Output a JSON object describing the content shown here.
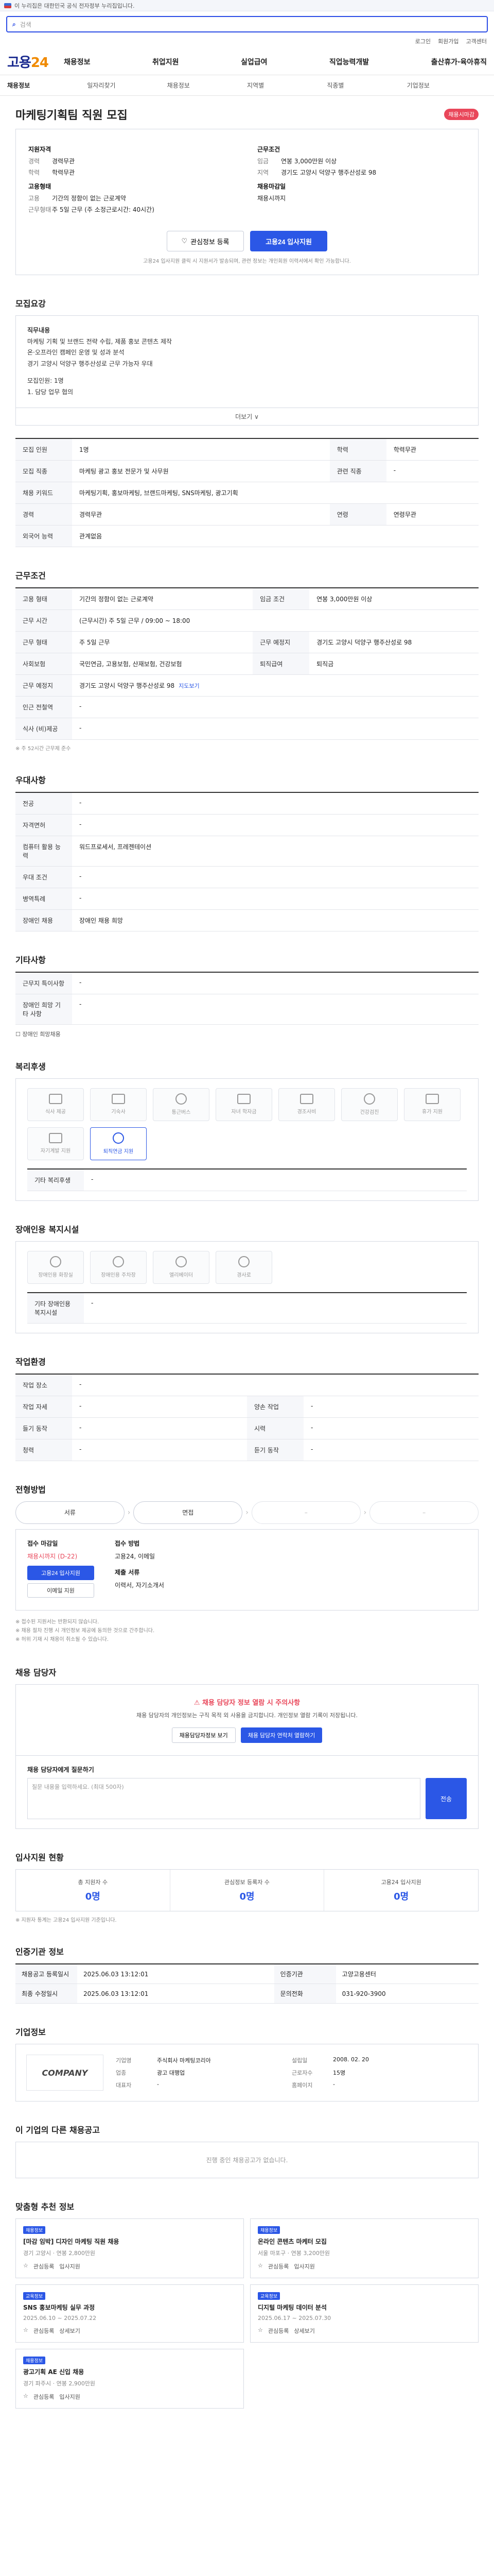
{
  "topbar": {
    "text": "이 누리집은 대한민국 공식 전자정부 누리집입니다."
  },
  "search": {
    "placeholder": "검색"
  },
  "util": {
    "items": [
      "로그인",
      "회원가입",
      "고객센터"
    ]
  },
  "logo": {
    "name": "고용",
    "num": "24"
  },
  "gnb": {
    "items": [
      "채용정보",
      "취업지원",
      "실업급여",
      "직업능력개발",
      "출산휴가·육아휴직"
    ]
  },
  "subnav": {
    "items": [
      "채용정보",
      "일자리찾기",
      "채용정보",
      "지역별",
      "직종별",
      "기업정보"
    ]
  },
  "job": {
    "title": "마케팅기획팀 직원 모집",
    "badge": "채용시마감",
    "left_label": "지원자격",
    "career_k": "경력",
    "career_v": "경력무관",
    "edu_k": "학력",
    "edu_v": "학력무관",
    "type_label": "고용형태",
    "type_k": "고용",
    "type_v": "기간의 정함이 없는 근로계약",
    "work_k": "근무형태",
    "work_v": "주 5일 근무 (주 소정근로시간: 40시간)",
    "right_label": "근무조건",
    "wage_k": "임금",
    "wage_v": "연봉 3,000만원 이상",
    "area_k": "지역",
    "area_v": "경기도 고양시 덕양구 행주산성로 98",
    "apply_label": "채용마감일",
    "apply_v": "채용시까지"
  },
  "actions": {
    "scrap": "관심정보 등록",
    "apply": "고용24 입사지원",
    "note": "고용24 입사지원 클릭 시 지원서가 발송되며, 관련 정보는 개인회원 이력서에서 확인 가능합니다."
  },
  "detail": {
    "title": "모집요강",
    "body": [
      "직무내용",
      "마케팅 기획 및 브랜드 전략 수립, 제품 홍보 콘텐츠 제작",
      "온·오프라인 캠페인 운영 및 성과 분석",
      "경기 고양시 덕양구 행주산성로 근무 가능자 우대",
      "",
      "모집인원: 1명",
      "1. 담당 업무 협의"
    ],
    "more": "더보기 ∨"
  },
  "recruit_table": [
    {
      "k": "모집 인원",
      "v": "1명",
      "k2": "학력",
      "v2": "학력무관"
    },
    {
      "k": "모집 직종",
      "v": "마케팅 광고 홍보 전문가 및 사무원",
      "k2": "관련 직종",
      "v2": "-"
    },
    {
      "k": "채용 키워드",
      "v": "마케팅기획, 홍보마케팅, 브랜드마케팅, SNS마케팅, 광고기획",
      "k2": "",
      "v2": ""
    },
    {
      "k": "경력",
      "v": "경력무관",
      "k2": "연령",
      "v2": "연령무관"
    },
    {
      "k": "외국어 능력",
      "v": "관계없음",
      "k2": "",
      "v2": ""
    }
  ],
  "work": {
    "title": "근무조건",
    "rows": [
      {
        "k": "고용 형태",
        "v": "기간의 정함이 없는 근로계약",
        "k2": "임금 조건",
        "v2": "연봉 3,000만원 이상"
      },
      {
        "k": "근무 시간",
        "v": "(근무시간) 주 5일 근무 / 09:00 ~ 18:00",
        "k2": "",
        "v2": ""
      },
      {
        "k": "근무 형태",
        "v": "주 5일 근무",
        "k2": "근무 예정지",
        "v2": "경기도 고양시 덕양구 행주산성로 98"
      },
      {
        "k": "사회보험",
        "v": "국민연금, 고용보험, 산재보험, 건강보험",
        "k2": "퇴직급여",
        "v2": "퇴직금"
      },
      {
        "k": "근무 예정지",
        "v": "경기도 고양시 덕양구 행주산성로 98",
        "k2": "",
        "v2": ""
      },
      {
        "k": "인근 전철역",
        "v": "-",
        "k2": "",
        "v2": ""
      },
      {
        "k": "식사 (비)제공",
        "v": "-",
        "k2": "",
        "v2": ""
      }
    ],
    "map": "지도보기",
    "note": "※ 주 52시간 근무제 준수"
  },
  "prefer": {
    "title": "우대사항",
    "rows": [
      {
        "k": "전공",
        "v": "-"
      },
      {
        "k": "자격면허",
        "v": "-"
      },
      {
        "k": "컴퓨터 활용 능력",
        "v": "워드프로세서, 프레젠테이션"
      },
      {
        "k": "우대 조건",
        "v": "-"
      },
      {
        "k": "병역특례",
        "v": "-"
      },
      {
        "k": "장애인 채용",
        "v": "장애인 채용 희망"
      }
    ]
  },
  "etc": {
    "title": "기타사항",
    "rows": [
      {
        "k": "근무지 특이사항",
        "v": "-"
      },
      {
        "k": "장애인 희망 기타 사항",
        "v": "-"
      }
    ],
    "checkbox": "장애인 희망채용"
  },
  "welfare": {
    "title": "복리후생",
    "tiles": [
      "식사 제공",
      "기숙사",
      "통근버스",
      "자녀 학자금",
      "경조사비",
      "건강검진",
      "휴가 지원",
      "자기계발 지원",
      "퇴직연금 지원"
    ],
    "active_index": 8,
    "extra_k": "기타 복리후생",
    "extra_v": "-"
  },
  "disabled": {
    "title": "장애인용 복지시설",
    "tiles": [
      "장애인용 화장실",
      "장애인용 주차장",
      "엘리베이터",
      "경사로"
    ],
    "extra_k": "기타 장애인용 복지시설",
    "extra_v": "-"
  },
  "env": {
    "title": "작업환경",
    "rows": [
      {
        "k": "작업 장소",
        "v": "-",
        "k2": "",
        "v2": ""
      },
      {
        "k": "작업 자세",
        "v": "-",
        "k2": "양손 작업",
        "v2": "-"
      },
      {
        "k": "들기 동작",
        "v": "-",
        "k2": "시력",
        "v2": "-"
      },
      {
        "k": "청력",
        "v": "-",
        "k2": "듣기 동작",
        "v2": "-"
      }
    ]
  },
  "process": {
    "title": "전형방법",
    "steps": [
      "서류",
      "면접",
      "",
      ""
    ],
    "apply_h": "접수 마감일",
    "apply_v": "채용시까지 (D-22)",
    "apply_btn": "고용24 입사지원",
    "email_btn": "이메일 지원",
    "method_h": "접수 방법",
    "method_v": "고용24, 이메일",
    "docs_h": "제출 서류",
    "docs_v": "이력서, 자기소개서",
    "notes": [
      "※ 접수된 지원서는 반환되지 않습니다.",
      "※ 채용 절차 진행 시 개인정보 제공에 동의한 것으로 간주합니다.",
      "※ 허위 기재 시 채용이 취소될 수 있습니다."
    ]
  },
  "contact": {
    "title": "채용 담당자",
    "warn": "채용 담당자 정보 열람 시 주의사항",
    "text": "채용 담당자의 개인정보는 구직 목적 외 사용을 금지합니다. 개인정보 열람 기록이 저장됩니다.",
    "btn1": "채용담당자정보 보기",
    "btn2": "채용 담당자 연락처 열람하기"
  },
  "qa": {
    "label": "채용 담당자에게 질문하기",
    "placeholder": "질문 내용을 입력하세요. (최대 500자)",
    "submit": "전송"
  },
  "stats": {
    "title": "입사지원 현황",
    "cells": [
      {
        "k": "총 지원자 수",
        "v": "0명"
      },
      {
        "k": "관심정보 등록자 수",
        "v": "0명"
      },
      {
        "k": "고용24 입사지원",
        "v": "0명"
      }
    ],
    "note": "※ 지원자 통계는 고용24 입사지원 기준입니다."
  },
  "info": {
    "title": "인증기관 정보",
    "rows": [
      {
        "k": "채용공고 등록일시",
        "v": "2025.06.03 13:12:01",
        "k2": "인증기관",
        "v2": "고양고용센터"
      },
      {
        "k": "최종 수정일시",
        "v": "2025.06.03 13:12:01",
        "k2": "문의전화",
        "v2": "031-920-3900"
      }
    ]
  },
  "company": {
    "title": "기업정보",
    "logo_text": "COMPANY",
    "rows": [
      {
        "k": "기업명",
        "v": "주식회사 마케팅코리아"
      },
      {
        "k": "업종",
        "v": "광고 대행업"
      },
      {
        "k": "대표자",
        "v": "-"
      },
      {
        "k": "설립일",
        "v": "2008. 02. 20"
      },
      {
        "k": "근로자수",
        "v": "15명"
      },
      {
        "k": "홈페이지",
        "v": "-"
      }
    ]
  },
  "other": {
    "title": "이 기업의 다른 채용공고",
    "empty": "진행 중인 채용공고가 없습니다."
  },
  "recommend": {
    "title": "맞춤형 추천 정보",
    "items": [
      {
        "tag": "채용정보",
        "title": "[마감 임박] 디자인 마케팅 직원 채용",
        "meta": "경기 고양시 · 연봉 2,800만원",
        "a1": "관심등록",
        "a2": "입사지원"
      },
      {
        "tag": "채용정보",
        "title": "온라인 콘텐츠 마케터 모집",
        "meta": "서울 마포구 · 연봉 3,200만원",
        "a1": "관심등록",
        "a2": "입사지원"
      },
      {
        "tag": "교육정보",
        "title": "SNS 홍보마케팅 실무 과정",
        "meta": "2025.06.10 ~ 2025.07.22",
        "a1": "관심등록",
        "a2": "상세보기"
      },
      {
        "tag": "교육정보",
        "title": "디지털 마케팅 데이터 분석",
        "meta": "2025.06.17 ~ 2025.07.30",
        "a1": "관심등록",
        "a2": "상세보기"
      },
      {
        "tag": "채용정보",
        "title": "광고기획 AE 신입 채용",
        "meta": "경기 파주시 · 연봉 2,900만원",
        "a1": "관심등록",
        "a2": "입사지원"
      }
    ]
  },
  "colors": {
    "accent": "#2b57e6",
    "logo": "#1a2a8f",
    "warn": "#e9475a"
  }
}
